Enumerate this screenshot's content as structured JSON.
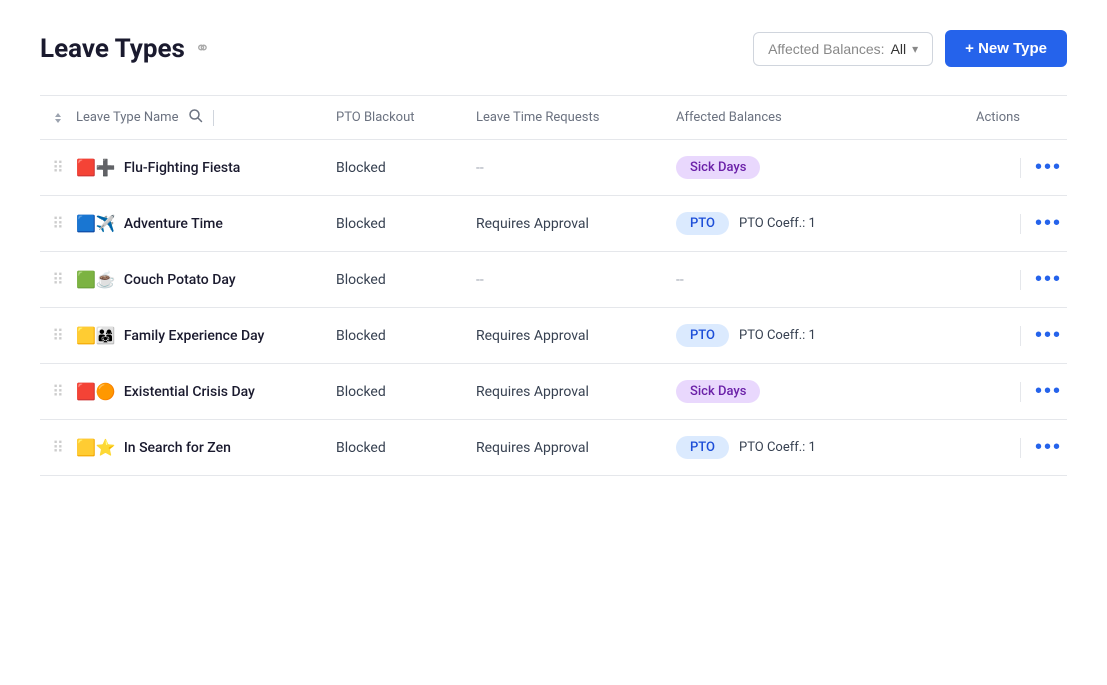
{
  "header": {
    "title": "Leave Types",
    "link_icon": "🔗",
    "filter_label": "Affected Balances:",
    "filter_value": "All",
    "new_type_label": "+ New Type"
  },
  "table": {
    "columns": [
      {
        "id": "sort",
        "label": ""
      },
      {
        "id": "name",
        "label": "Leave Type Name"
      },
      {
        "id": "blackout",
        "label": "PTO Blackout"
      },
      {
        "id": "requests",
        "label": "Leave Time Requests"
      },
      {
        "id": "balances",
        "label": "Affected Balances"
      },
      {
        "id": "actions",
        "label": "Actions"
      }
    ],
    "rows": [
      {
        "id": 1,
        "icons": "🟥➕",
        "name": "Flu-Fighting Fiesta",
        "blackout": "Blocked",
        "requests": "--",
        "badge1": "Sick Days",
        "badge1_type": "sick",
        "badge2": "",
        "coeff": ""
      },
      {
        "id": 2,
        "icons": "🟦✈️",
        "name": "Adventure Time",
        "blackout": "Blocked",
        "requests": "Requires Approval",
        "badge1": "PTO",
        "badge1_type": "pto",
        "badge2": "",
        "coeff": "PTO Coeff.: 1"
      },
      {
        "id": 3,
        "icons": "🟩☕",
        "name": "Couch Potato Day",
        "blackout": "Blocked",
        "requests": "--",
        "badge1": "",
        "badge1_type": "",
        "badge2": "--",
        "coeff": ""
      },
      {
        "id": 4,
        "icons": "🟨👨‍👩‍👧",
        "name": "Family Experience Day",
        "blackout": "Blocked",
        "requests": "Requires Approval",
        "badge1": "PTO",
        "badge1_type": "pto",
        "badge2": "",
        "coeff": "PTO Coeff.: 1"
      },
      {
        "id": 5,
        "icons": "🟥🟠",
        "name": "Existential Crisis Day",
        "blackout": "Blocked",
        "requests": "Requires Approval",
        "badge1": "Sick Days",
        "badge1_type": "sick",
        "badge2": "",
        "coeff": ""
      },
      {
        "id": 6,
        "icons": "🟨⭐",
        "name": "In Search for Zen",
        "blackout": "Blocked",
        "requests": "Requires Approval",
        "badge1": "PTO",
        "badge1_type": "pto",
        "badge2": "",
        "coeff": "PTO Coeff.: 1"
      }
    ]
  }
}
